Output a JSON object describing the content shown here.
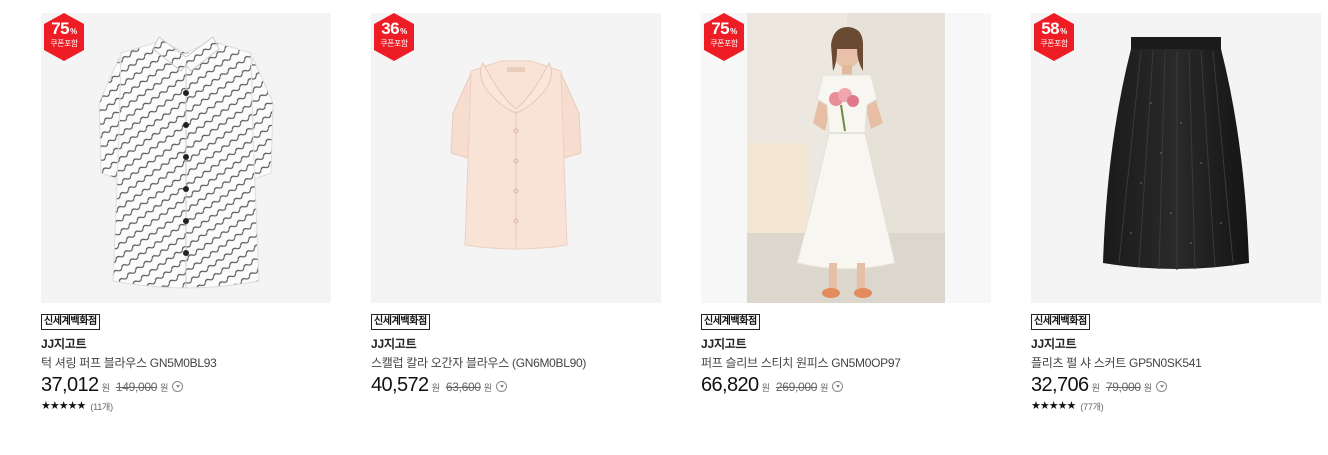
{
  "products": [
    {
      "discount": "75",
      "discount_unit": "%",
      "coupon": "쿠폰포함",
      "store": "신세계백화점",
      "brand": "JJ지고트",
      "title": "턱 셔링 퍼프 블라우스 GN5M0BL93",
      "price": "37,012",
      "currency": "원",
      "original_price": "149,000",
      "stars": "★★★★★",
      "reviews": "(11개)"
    },
    {
      "discount": "36",
      "discount_unit": "%",
      "coupon": "쿠폰포함",
      "store": "신세계백화점",
      "brand": "JJ지고트",
      "title": "스캘럽 칼라 오간자 블라우스 (GN6M0BL90)",
      "price": "40,572",
      "currency": "원",
      "original_price": "63,600"
    },
    {
      "discount": "75",
      "discount_unit": "%",
      "coupon": "쿠폰포함",
      "store": "신세계백화점",
      "brand": "JJ지고트",
      "title": "퍼프 슬리브 스티치 원피스 GN5M0OP97",
      "price": "66,820",
      "currency": "원",
      "original_price": "269,000"
    },
    {
      "discount": "58",
      "discount_unit": "%",
      "coupon": "쿠폰포함",
      "store": "신세계백화점",
      "brand": "JJ지고트",
      "title": "플리츠 펄 샤 스커트 GP5N0SK541",
      "price": "32,706",
      "currency": "원",
      "original_price": "79,000",
      "stars": "★★★★★",
      "reviews": "(77개)"
    }
  ],
  "colors": {
    "badge": "#ee1c25",
    "text": "#222222",
    "muted": "#666666"
  }
}
